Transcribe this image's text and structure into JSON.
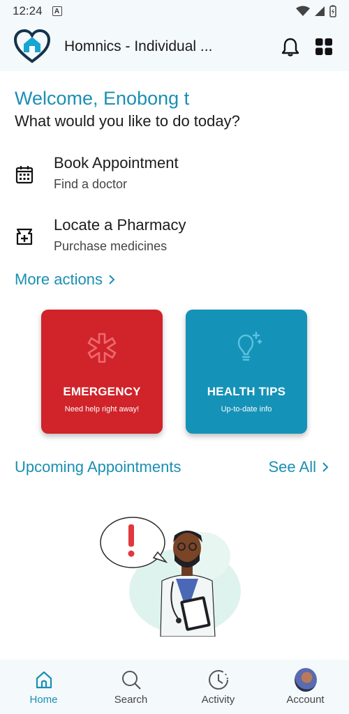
{
  "status_bar": {
    "time": "12:24",
    "badge": "A"
  },
  "app_bar": {
    "title": "Homnics - Individual ...",
    "logo_icon": "heart-house-logo",
    "notification_icon": "bell-icon",
    "menu_icon": "grid-icon"
  },
  "welcome": {
    "greeting": "Welcome, Enobong t",
    "question": "What would you like to do today?"
  },
  "actions": [
    {
      "title": "Book Appointment",
      "subtitle": "Find a doctor",
      "icon": "calendar-icon"
    },
    {
      "title": "Locate a Pharmacy",
      "subtitle": "Purchase medicines",
      "icon": "pharmacy-icon"
    }
  ],
  "more_actions": "More actions",
  "cards": [
    {
      "title": "EMERGENCY",
      "subtitle": "Need help right away!",
      "color": "#d0232a",
      "icon": "medical-star-icon"
    },
    {
      "title": "HEALTH TIPS",
      "subtitle": "Up-to-date info",
      "color": "#1592b8",
      "icon": "lightbulb-icon"
    }
  ],
  "upcoming": {
    "title": "Upcoming Appointments",
    "see_all": "See All"
  },
  "bottom_nav": [
    {
      "label": "Home",
      "icon": "home-icon",
      "active": true
    },
    {
      "label": "Search",
      "icon": "search-icon",
      "active": false
    },
    {
      "label": "Activity",
      "icon": "clock-icon",
      "active": false
    },
    {
      "label": "Account",
      "icon": "avatar",
      "active": false
    }
  ],
  "colors": {
    "accent": "#1a8fb3",
    "emergency": "#d0232a",
    "tips": "#1592b8",
    "bar_bg": "#f4f9fc"
  }
}
